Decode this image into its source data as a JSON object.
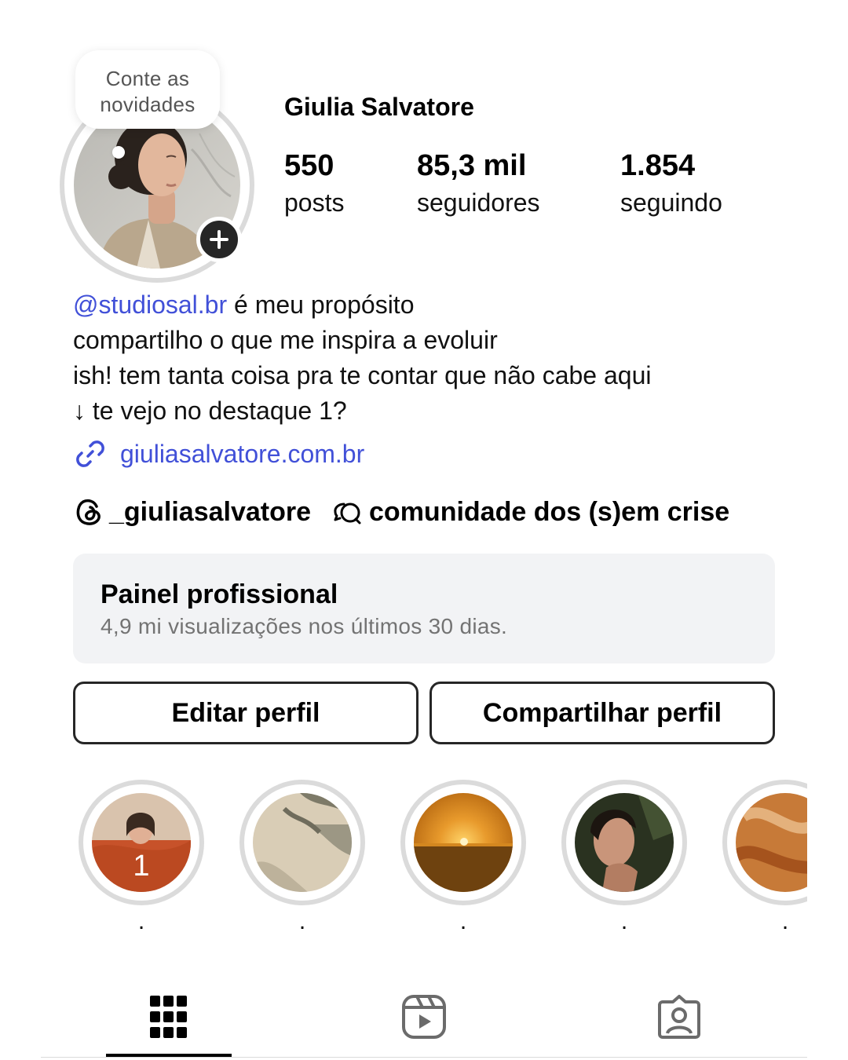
{
  "note": {
    "text_line1": "Conte as",
    "text_line2": "novidades"
  },
  "profile": {
    "username": "Giulia Salvatore",
    "stats": [
      {
        "number": "550",
        "label": "posts"
      },
      {
        "number": "85,3 mil",
        "label": "seguidores"
      },
      {
        "number": "1.854",
        "label": "seguindo"
      }
    ]
  },
  "bio": {
    "mention": "@studiosal.br",
    "line1_rest": " é meu propósito",
    "line2": "compartilho o que me inspira a evoluir",
    "line3": "ish! tem tanta coisa pra te contar que não cabe aqui",
    "line4": "↓ te vejo no destaque 1?"
  },
  "link": {
    "icon": "link-icon",
    "text": "giuliasalvatore.com.br"
  },
  "social": {
    "threads": {
      "icon": "threads-icon",
      "text": "_giuliasalvatore"
    },
    "channel": {
      "icon": "chat-bubbles-icon",
      "text": "comunidade dos (s)em crise"
    }
  },
  "dashboard": {
    "title": "Painel profissional",
    "subtitle": "4,9 mi visualizações nos últimos 30 dias."
  },
  "buttons": {
    "edit": "Editar perfil",
    "share": "Compartilhar perfil"
  },
  "highlights": [
    {
      "label": ".",
      "overlay": "1",
      "palette": [
        "#c86a3a",
        "#8a3b20"
      ]
    },
    {
      "label": ".",
      "overlay": "",
      "palette": [
        "#d9cdb6",
        "#8c8a78"
      ]
    },
    {
      "label": ".",
      "overlay": "",
      "palette": [
        "#e89a2c",
        "#7a4a10"
      ]
    },
    {
      "label": ".",
      "overlay": "",
      "palette": [
        "#3f4a33",
        "#1e2418"
      ]
    },
    {
      "label": ".",
      "overlay": "",
      "palette": [
        "#c77a38",
        "#f1c99a"
      ]
    }
  ],
  "tabs": [
    {
      "name": "grid",
      "icon": "grid-icon",
      "active": true
    },
    {
      "name": "reels",
      "icon": "reels-icon",
      "active": false
    },
    {
      "name": "tagged",
      "icon": "tagged-person-icon",
      "active": false
    }
  ],
  "colors": {
    "link": "#4150d8",
    "ring": "#dbdbdb",
    "panel": "#f2f3f5"
  }
}
